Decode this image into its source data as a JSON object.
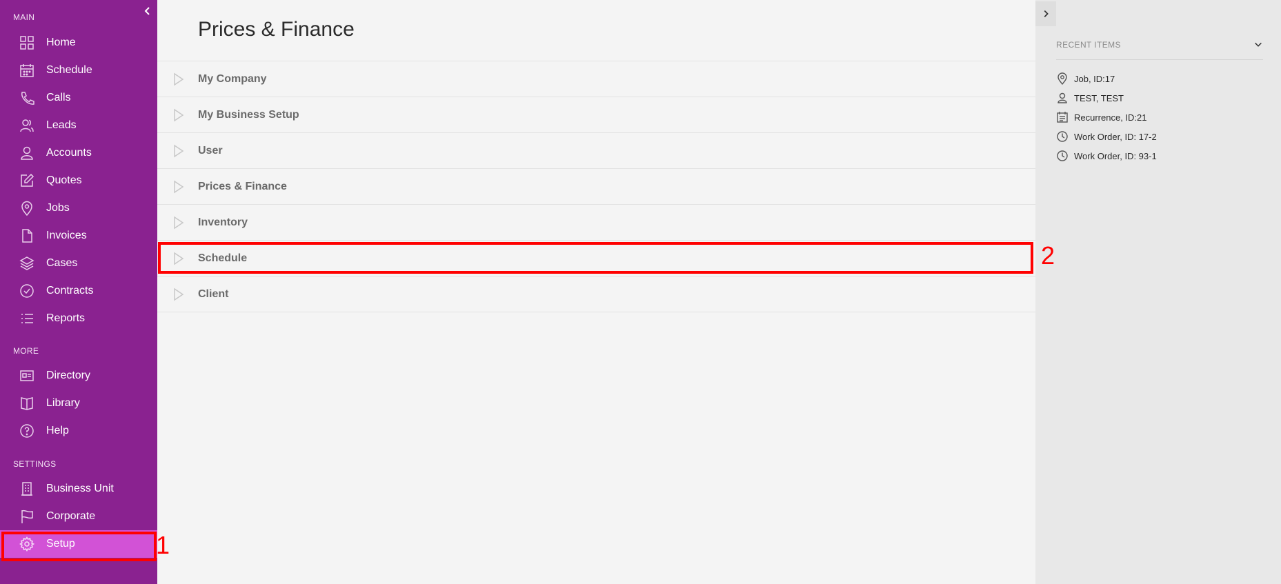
{
  "sidebar": {
    "sections": [
      {
        "label": "MAIN"
      },
      {
        "label": "MORE"
      },
      {
        "label": "SETTINGS"
      }
    ],
    "items": [
      {
        "label": "Home",
        "icon": "grid-icon"
      },
      {
        "label": "Schedule",
        "icon": "calendar-icon"
      },
      {
        "label": "Calls",
        "icon": "phone-icon"
      },
      {
        "label": "Leads",
        "icon": "users-icon"
      },
      {
        "label": "Accounts",
        "icon": "user-icon"
      },
      {
        "label": "Quotes",
        "icon": "edit-icon"
      },
      {
        "label": "Jobs",
        "icon": "map-pin-icon"
      },
      {
        "label": "Invoices",
        "icon": "document-icon"
      },
      {
        "label": "Cases",
        "icon": "layers-icon"
      },
      {
        "label": "Contracts",
        "icon": "check-circle-icon"
      },
      {
        "label": "Reports",
        "icon": "list-icon"
      },
      {
        "label": "Directory",
        "icon": "id-card-icon"
      },
      {
        "label": "Library",
        "icon": "book-icon"
      },
      {
        "label": "Help",
        "icon": "help-circle-icon"
      },
      {
        "label": "Business Unit",
        "icon": "building-icon"
      },
      {
        "label": "Corporate",
        "icon": "flag-icon"
      },
      {
        "label": "Setup",
        "icon": "gear-icon",
        "active": true
      }
    ]
  },
  "main": {
    "title": "Prices & Finance",
    "sections": [
      {
        "label": "My Company"
      },
      {
        "label": "My Business Setup"
      },
      {
        "label": "User"
      },
      {
        "label": "Prices & Finance"
      },
      {
        "label": "Inventory"
      },
      {
        "label": "Schedule"
      },
      {
        "label": "Client"
      }
    ]
  },
  "recent": {
    "title": "RECENT ITEMS",
    "items": [
      {
        "label": "Job, ID:17",
        "icon": "map-pin-icon"
      },
      {
        "label": "TEST, TEST",
        "icon": "user-icon"
      },
      {
        "label": "Recurrence, ID:21",
        "icon": "calendar-list-icon"
      },
      {
        "label": "Work Order, ID: 17-2",
        "icon": "clock-icon"
      },
      {
        "label": "Work Order, ID: 93-1",
        "icon": "clock-icon"
      }
    ]
  },
  "annotations": [
    {
      "label": "1"
    },
    {
      "label": "2"
    }
  ],
  "colors": {
    "sidebar": "#8a2290",
    "sidebar_active": "#d252d6",
    "annotation": "#ff0000"
  }
}
